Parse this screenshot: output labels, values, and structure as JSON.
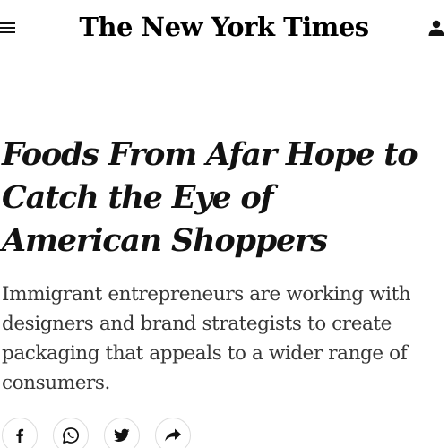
{
  "header": {
    "masthead": "The New York Times",
    "menu_icon": "hamburger-menu-icon",
    "account_icon": "user-account-icon"
  },
  "article": {
    "headline": "Foods From Afar Hope to Catch the Eye of American Shoppers",
    "summary": "Immigrant entrepreneurs are working with designers and brand strategists to create packaging that appeals to a wider range of consumers."
  },
  "share": {
    "buttons": [
      {
        "icon": "facebook-icon"
      },
      {
        "icon": "whatsapp-icon"
      },
      {
        "icon": "twitter-icon"
      },
      {
        "icon": "share-arrow-icon"
      }
    ]
  },
  "colors": {
    "text": "#121212",
    "summary_text": "#363636",
    "divider": "#e6e6e6"
  }
}
